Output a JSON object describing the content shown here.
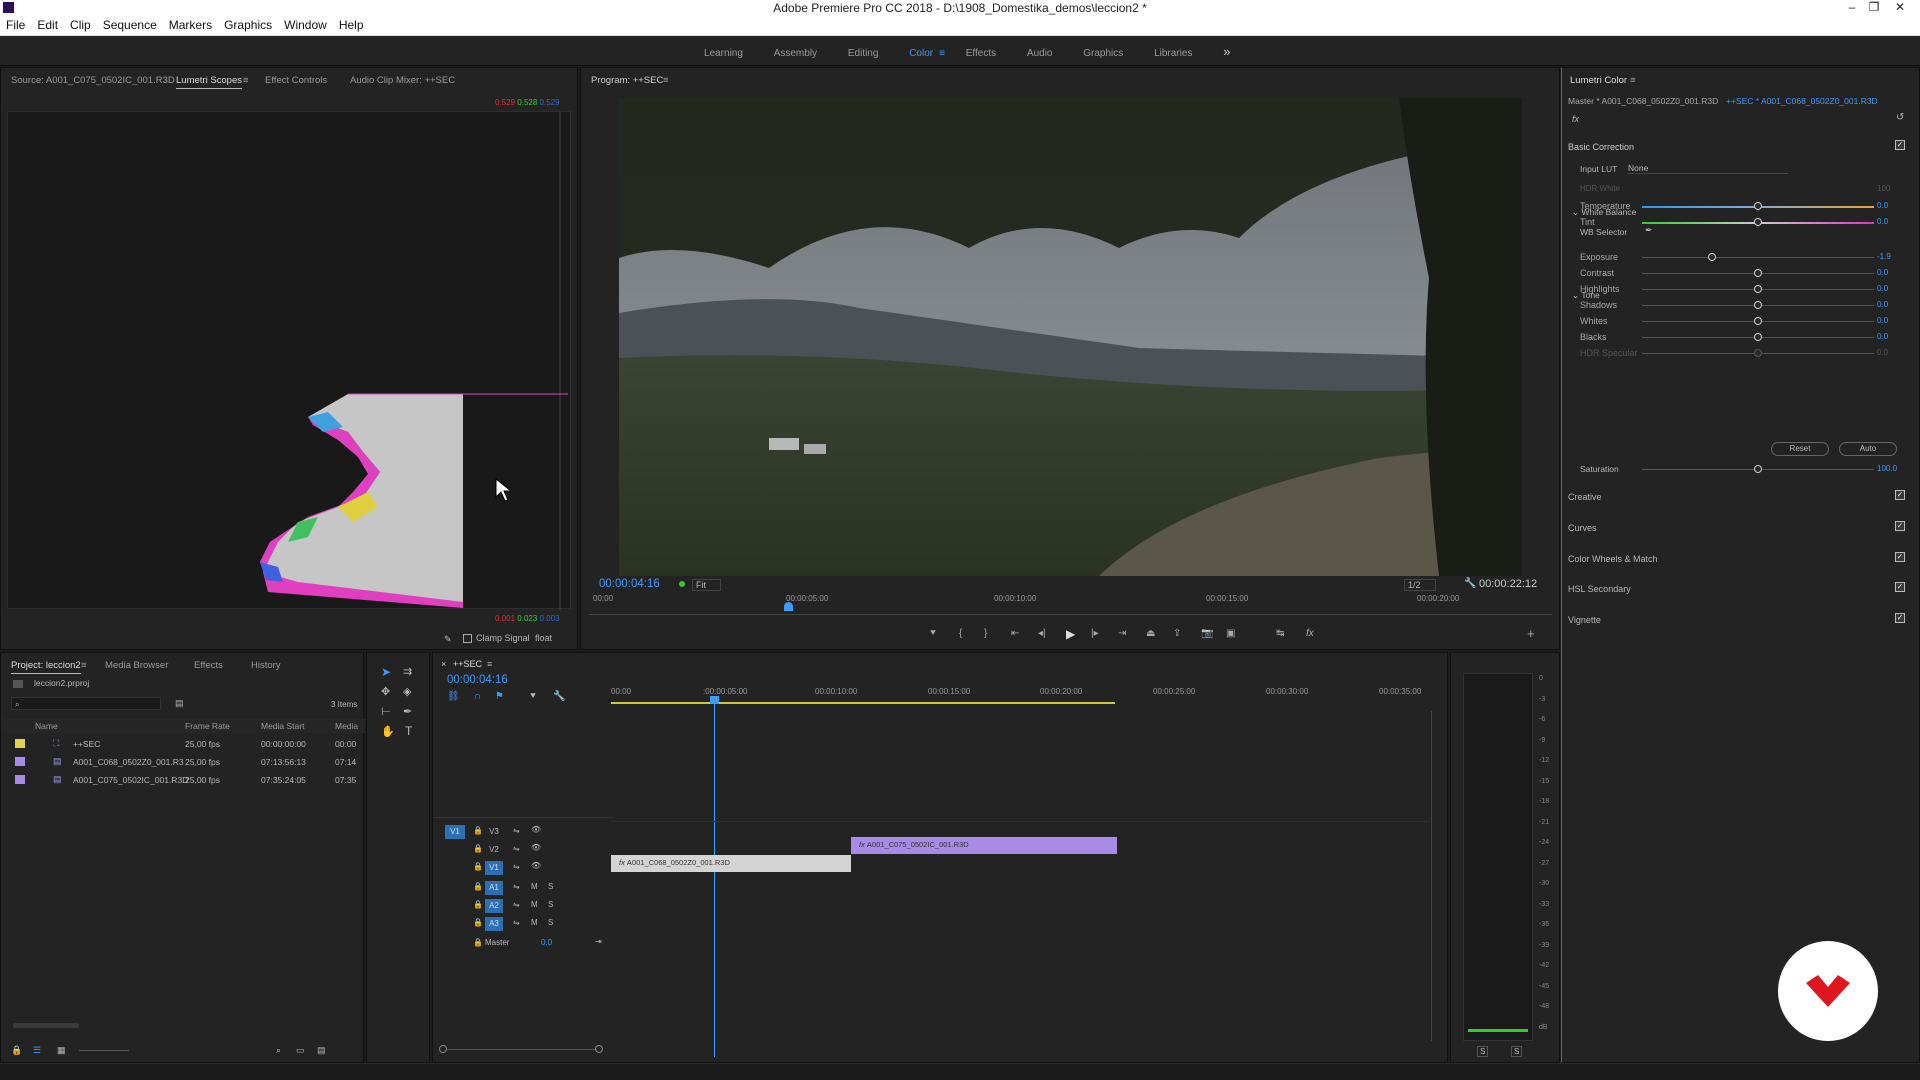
{
  "titlebar": {
    "title": "Adobe Premiere Pro CC 2018 - D:\\1908_Domestika_demos\\leccion2 *"
  },
  "menu": [
    "File",
    "Edit",
    "Clip",
    "Sequence",
    "Markers",
    "Graphics",
    "Window",
    "Help"
  ],
  "workspaces": {
    "tabs": [
      "Learning",
      "Assembly",
      "Editing",
      "Color",
      "Effects",
      "Audio",
      "Graphics",
      "Libraries"
    ],
    "active": "Color",
    "more": "»"
  },
  "source_panel": {
    "tabs": [
      "Source: A001_C075_0502IC_001.R3D",
      "Lumetri Scopes",
      "Effect Controls",
      "Audio Clip Mixer: ++SEC"
    ],
    "active": "Lumetri Scopes",
    "top_values": [
      "0.529",
      "0.528",
      "0.529"
    ],
    "bottom_values": [
      "0.001",
      "0.023",
      "0.003"
    ],
    "clamp_label": "Clamp Signal",
    "float_label": "float"
  },
  "program": {
    "header": "Program: ++SEC",
    "timecode": "00:00:04:16",
    "fit": "Fit",
    "resolution": "1/2",
    "duration": "00:00:22:12",
    "ruler": [
      "00:00",
      "00:00:05:00",
      "00:00:10:00",
      "00:00:15:00",
      "00:00:20:00"
    ]
  },
  "lumetri": {
    "title": "Lumetri Color",
    "master": "Master * A001_C068_0502Z0_001.R3D",
    "sequence_clip": "++SEC * A001_C068_0502Z0_001.R3D",
    "fx": "fx",
    "basic_correction": "Basic Correction",
    "input_lut_label": "Input LUT",
    "input_lut_value": "None",
    "hdr_white_label": "HDR White",
    "hdr_white_value": "100",
    "white_balance": "White Balance",
    "wb_selector": "WB Selector",
    "tone": "Tone",
    "sliders": [
      {
        "label": "Temperature",
        "value": "0.0",
        "pos": 0.5
      },
      {
        "label": "Tint",
        "value": "0.0",
        "pos": 0.5
      },
      {
        "label": "Exposure",
        "value": "-1.9",
        "pos": 0.3
      },
      {
        "label": "Contrast",
        "value": "0.0",
        "pos": 0.5
      },
      {
        "label": "Highlights",
        "value": "0.0",
        "pos": 0.5
      },
      {
        "label": "Shadows",
        "value": "0.0",
        "pos": 0.5
      },
      {
        "label": "Whites",
        "value": "0.0",
        "pos": 0.5
      },
      {
        "label": "Blacks",
        "value": "0.0",
        "pos": 0.5
      },
      {
        "label": "HDR Specular",
        "value": "0.0",
        "pos": 0.5
      }
    ],
    "reset": "Reset",
    "auto": "Auto",
    "saturation_label": "Saturation",
    "saturation_value": "100.0",
    "sections": [
      "Creative",
      "Curves",
      "Color Wheels & Match",
      "HSL Secondary",
      "Vignette"
    ]
  },
  "project": {
    "tabs": [
      "Project: leccion2",
      "Media Browser",
      "Effects",
      "History"
    ],
    "file": "leccion2.prproj",
    "items_count": "3 Items",
    "columns": [
      "Name",
      "Frame Rate",
      "Media Start",
      "Media"
    ],
    "rows": [
      {
        "name": "++SEC",
        "rate": "25,00 fps",
        "start": "00:00:00:00",
        "media": "00:00",
        "color": "#e1d24a"
      },
      {
        "name": "A001_C068_0502Z0_001.R3",
        "rate": "25,00 fps",
        "start": "07:13:56:13",
        "media": "07:14",
        "color": "#a98ae6"
      },
      {
        "name": "A001_C075_0502IC_001.R3D",
        "rate": "25,00 fps",
        "start": "07:35:24:05",
        "media": "07:35",
        "color": "#a98ae6"
      }
    ]
  },
  "timeline": {
    "title": "++SEC",
    "timecode": "00:00:04:16",
    "ruler": [
      "00:00",
      ":00:00:05:00",
      "00:00:10:00",
      "00:00:15:00",
      "00:00:20:00",
      "00:00:25:00",
      "00:00:30:00",
      "00:00:35:00"
    ],
    "tracks_video": [
      "V3",
      "V2",
      "V1"
    ],
    "tracks_audio": [
      "A1",
      "A2",
      "A3"
    ],
    "master": "Master",
    "master_value": "0.0",
    "clip_v1": "A001_C068_0502Z0_001.R3D",
    "clip_v2": "A001_C075_0502IC_001.R3D",
    "m": "M",
    "s": "S"
  },
  "meter_scale": [
    "0",
    "-3",
    "-6",
    "-9",
    "-12",
    "-15",
    "-18",
    "-21",
    "-24",
    "-27",
    "-30",
    "-33",
    "-36",
    "-39",
    "-42",
    "-45",
    "-48",
    "dB"
  ],
  "meter_solo": [
    "S",
    "S"
  ]
}
